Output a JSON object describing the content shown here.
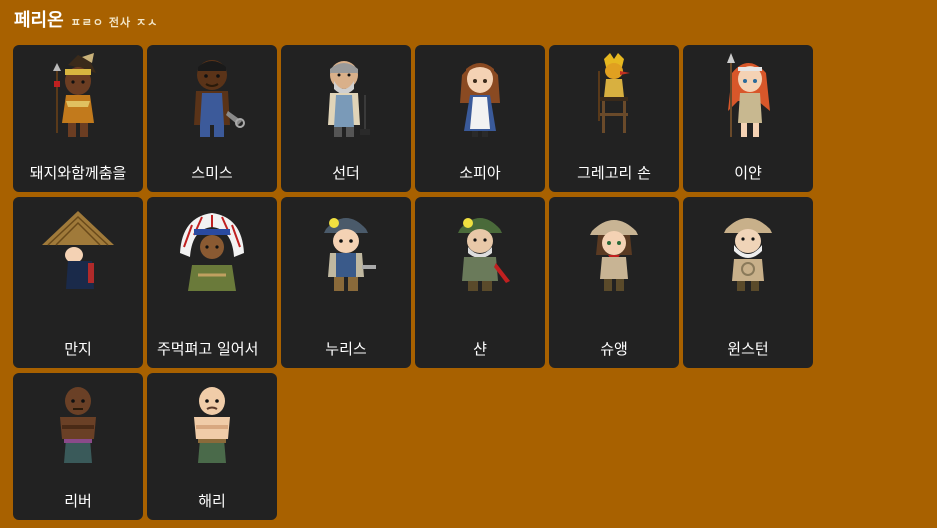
{
  "header": {
    "title": "페리온",
    "subtitle": "ㅍㄹㅇ 전사 ㅈㅅ"
  },
  "colors": {
    "background": "#a86100",
    "card": "#222222",
    "text": "#ffffff"
  },
  "npcs": [
    {
      "name": "돼지와함께춤을",
      "icon": "tribal-warrior-icon"
    },
    {
      "name": "스미스",
      "icon": "blacksmith-icon"
    },
    {
      "name": "선더",
      "icon": "old-smith-icon"
    },
    {
      "name": "소피아",
      "icon": "maid-girl-icon"
    },
    {
      "name": "그레고리 손",
      "icon": "golden-bird-man-icon"
    },
    {
      "name": "이얀",
      "icon": "red-haired-spear-girl-icon"
    },
    {
      "name": "만지",
      "icon": "straw-hat-swordsman-icon"
    },
    {
      "name": "주먹펴고 일어서",
      "icon": "chief-headdress-icon"
    },
    {
      "name": "누리스",
      "icon": "miner-helmet-icon"
    },
    {
      "name": "샨",
      "icon": "old-miner-icon"
    },
    {
      "name": "슈앵",
      "icon": "explorer-girl-icon"
    },
    {
      "name": "윈스턴",
      "icon": "old-explorer-icon"
    },
    {
      "name": "리버",
      "icon": "muscular-man-icon"
    },
    {
      "name": "해리",
      "icon": "bald-fighter-icon"
    }
  ]
}
